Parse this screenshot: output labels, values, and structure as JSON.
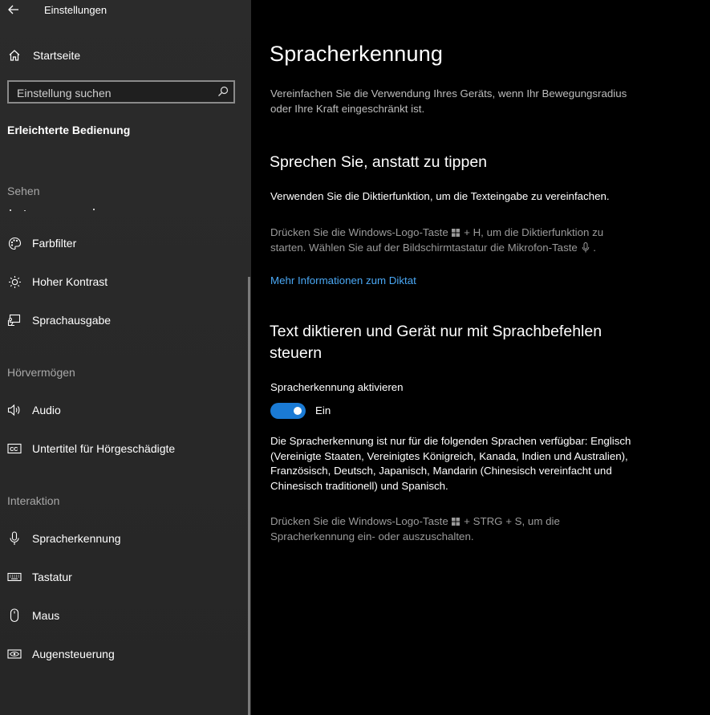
{
  "window": {
    "title": "Einstellungen"
  },
  "sidebar": {
    "home_label": "Startseite",
    "search_placeholder": "Einstellung suchen",
    "section_title": "Erleichterte Bedienung",
    "groups": {
      "sehen": "Sehen",
      "hoeren": "Hörvermögen",
      "interaktion": "Interaktion"
    },
    "items": {
      "farbfilter": "Farbfilter",
      "hoher_kontrast": "Hoher Kontrast",
      "sprachausgabe": "Sprachausgabe",
      "audio": "Audio",
      "untertitel": "Untertitel für Hörgeschädigte",
      "spracherkennung": "Spracherkennung",
      "tastatur": "Tastatur",
      "maus": "Maus",
      "augensteuerung": "Augensteuerung"
    }
  },
  "main": {
    "title": "Spracherkennung",
    "intro": "Vereinfachen Sie die Verwendung Ihres Geräts, wenn Ihr Bewegungsradius oder Ihre Kraft eingeschränkt ist.",
    "section1": {
      "heading": "Sprechen Sie, anstatt zu tippen",
      "body": "Verwenden Sie die Diktierfunktion, um die Texteingabe zu vereinfachen.",
      "hint_part1": "Drücken Sie die Windows-Logo-Taste",
      "hint_part2": "+ H, um die Diktierfunktion zu starten. Wählen Sie auf der Bildschirmtastatur die Mikrofon-Taste",
      "hint_part3": ".",
      "link": "Mehr Informationen zum Diktat"
    },
    "section2": {
      "heading": "Text diktieren und Gerät nur mit Sprachbefehlen steuern",
      "toggle_label": "Spracherkennung aktivieren",
      "toggle_state": "Ein",
      "toggle_on": true,
      "body": "Die Spracherkennung ist nur für die folgenden Sprachen verfügbar: Englisch (Vereinigte Staaten, Vereinigtes Königreich, Kanada, Indien und Australien), Französisch, Deutsch, Japanisch, Mandarin (Chinesisch vereinfacht und Chinesisch traditionell) und Spanisch.",
      "hint_part1": "Drücken Sie die Windows-Logo-Taste",
      "hint_part2": "+ STRG + S, um die Spracherkennung ein- oder auszuschalten."
    }
  },
  "colors": {
    "accent": "#1a7ad4",
    "link": "#4aa8f5",
    "sidebar_bg": "#2b2b2b",
    "main_bg": "#000000"
  }
}
